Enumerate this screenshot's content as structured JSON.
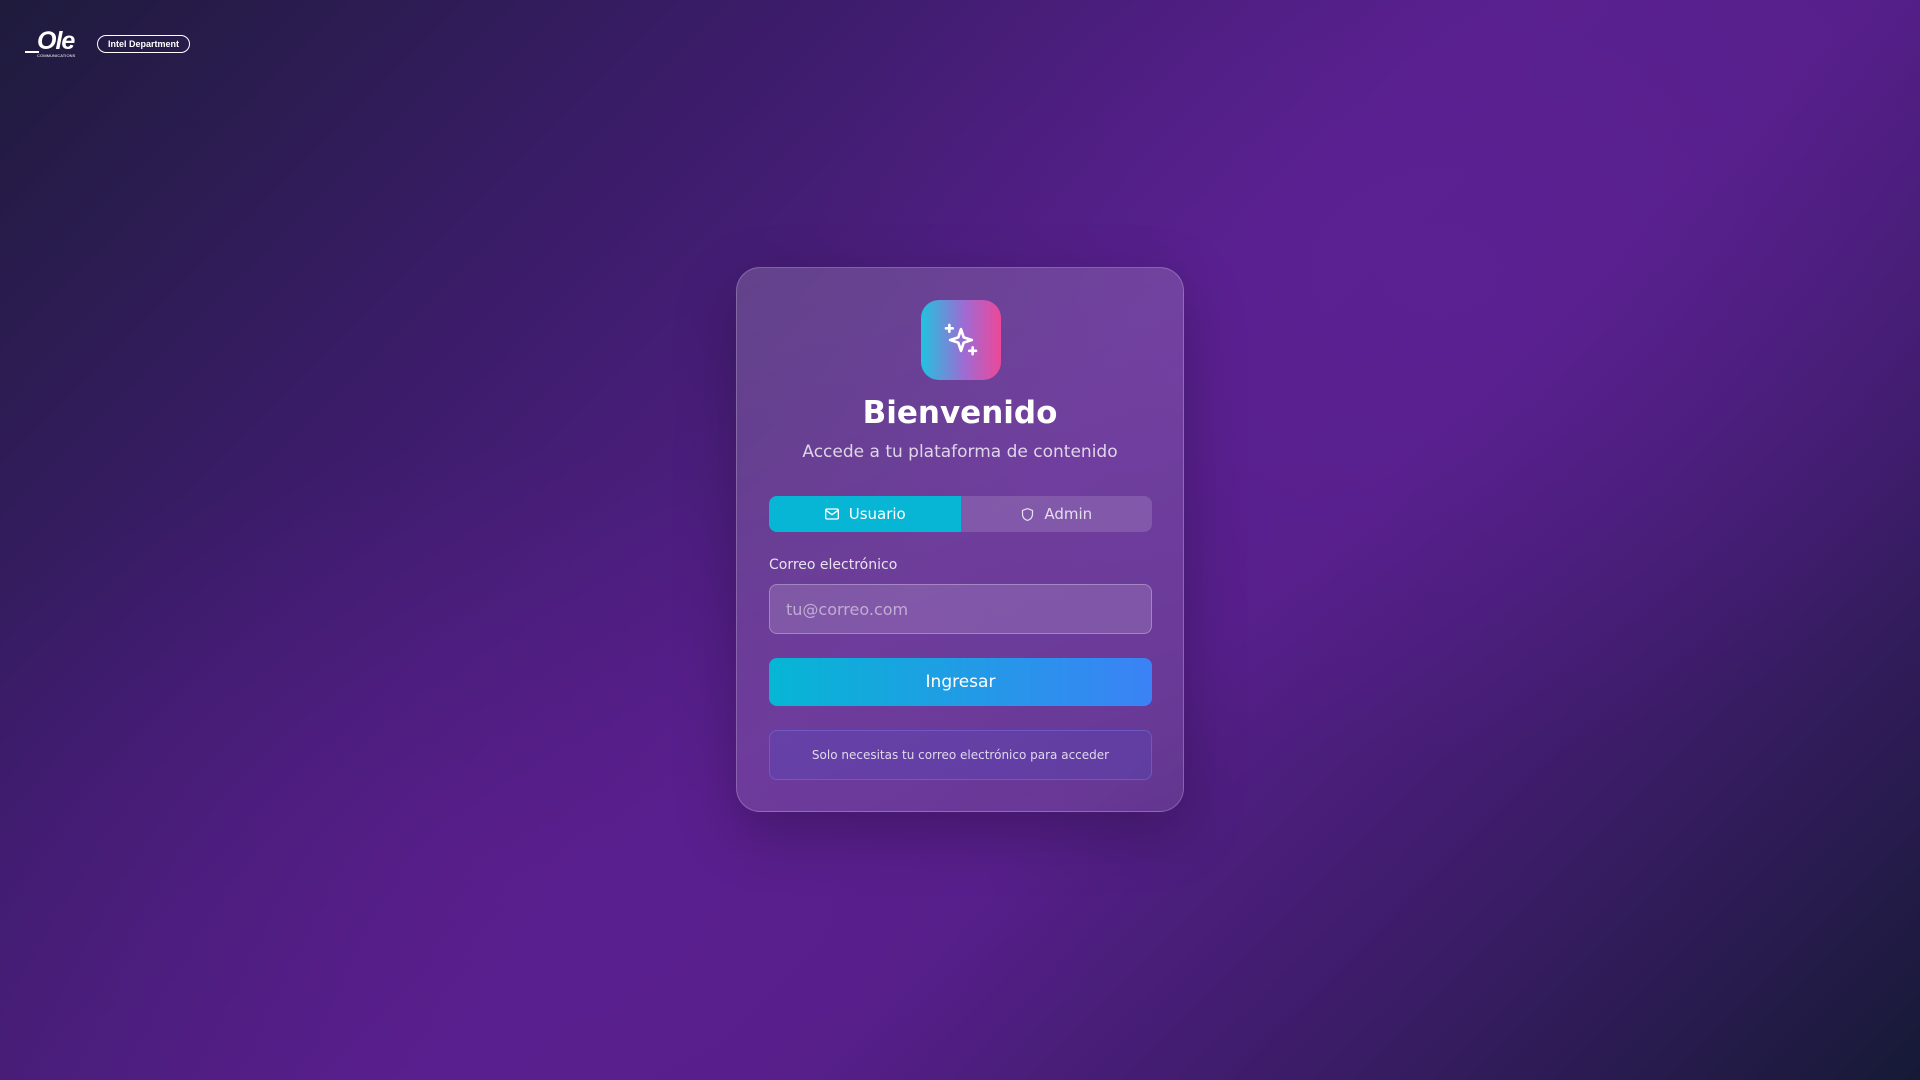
{
  "brand": {
    "logo_text": "Ole",
    "logo_subtext": "COMMUNICATIONS",
    "department_badge": "Intel Department"
  },
  "login": {
    "icon": "sparkles-icon",
    "title": "Bienvenido",
    "subtitle": "Accede a tu plataforma de contenido",
    "tabs": [
      {
        "label": "Usuario",
        "icon": "mail-icon",
        "active": true
      },
      {
        "label": "Admin",
        "icon": "shield-icon",
        "active": false
      }
    ],
    "email_label": "Correo electrónico",
    "email_value": "",
    "email_placeholder": "tu@correo.com",
    "submit_label": "Ingresar",
    "hint": "Solo necesitas tu correo electrónico para acceder"
  },
  "colors": {
    "accent_cyan": "#06b6d4",
    "accent_blue": "#3b82f6",
    "accent_pink": "#ec4899"
  }
}
